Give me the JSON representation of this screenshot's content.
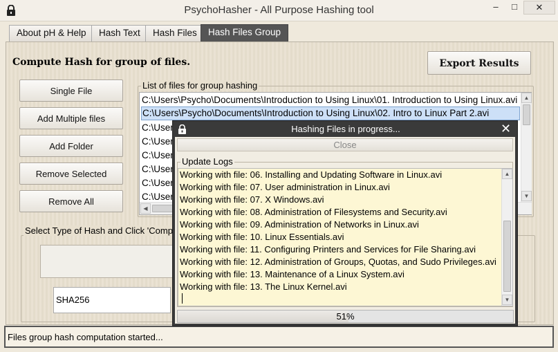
{
  "window": {
    "title": "PsychoHasher - All Purpose Hashing tool",
    "minimize_label": "–",
    "maximize_label": "□",
    "close_label": "✕"
  },
  "tabs": [
    {
      "label": "About pH & Help",
      "active": false
    },
    {
      "label": "Hash Text",
      "active": false
    },
    {
      "label": "Hash Files",
      "active": false
    },
    {
      "label": "Hash Files Group",
      "active": true
    }
  ],
  "main": {
    "section_title": "Compute Hash for group of files.",
    "export_button": "Export Results",
    "buttons": {
      "single_file": "Single File",
      "add_multiple": "Add Multiple files",
      "add_folder": "Add Folder",
      "remove_selected": "Remove Selected",
      "remove_all": "Remove All"
    },
    "file_list_label": "List of files for group hashing",
    "files": [
      "C:\\Users\\Psycho\\Documents\\Introduction to Using Linux\\01. Introduction to Using Linux.avi",
      "C:\\Users\\Psycho\\Documents\\Introduction to Using Linux\\02. Intro to Linux Part 2.avi",
      "C:\\User",
      "C:\\User",
      "C:\\User",
      "C:\\User",
      "C:\\User",
      "C:\\User"
    ],
    "selected_file_index": 1,
    "hash_section_label": "Select Type of Hash and Click 'Comp",
    "hash_type": "SHA256"
  },
  "status": {
    "text": "Files group hash computation started..."
  },
  "dialog": {
    "title": "Hashing Files in progress...",
    "close_label": "Close",
    "logs_label": "Update Logs",
    "logs": [
      "Working with file: 06. Installing and Updating Software in Linux.avi",
      "Working with file: 07. User administration in Linux.avi",
      "Working with file: 07. X Windows.avi",
      "Working with file: 08. Administration of Filesystems and Security.avi",
      "Working with file: 09. Administration of Networks in Linux.avi",
      "Working with file: 10. Linux Essentials.avi",
      "Working with file: 11. Configuring Printers and Services for File Sharing.avi",
      "Working with file: 12. Administration of Groups, Quotas, and Sudo Privileges.avi",
      "Working with file: 13. Maintenance of a Linux System.avi",
      "Working with file: 13. The Linux Kernel.avi"
    ],
    "progress_percent": 51,
    "progress_label": "51%"
  },
  "colors": {
    "active_tab": "#555555",
    "selection": "#cde0f7",
    "log_background": "#fdf7d4",
    "dialog_frame": "#3a3a3a"
  },
  "icons": {
    "app": "padlock-icon",
    "dialog": "padlock-icon"
  }
}
